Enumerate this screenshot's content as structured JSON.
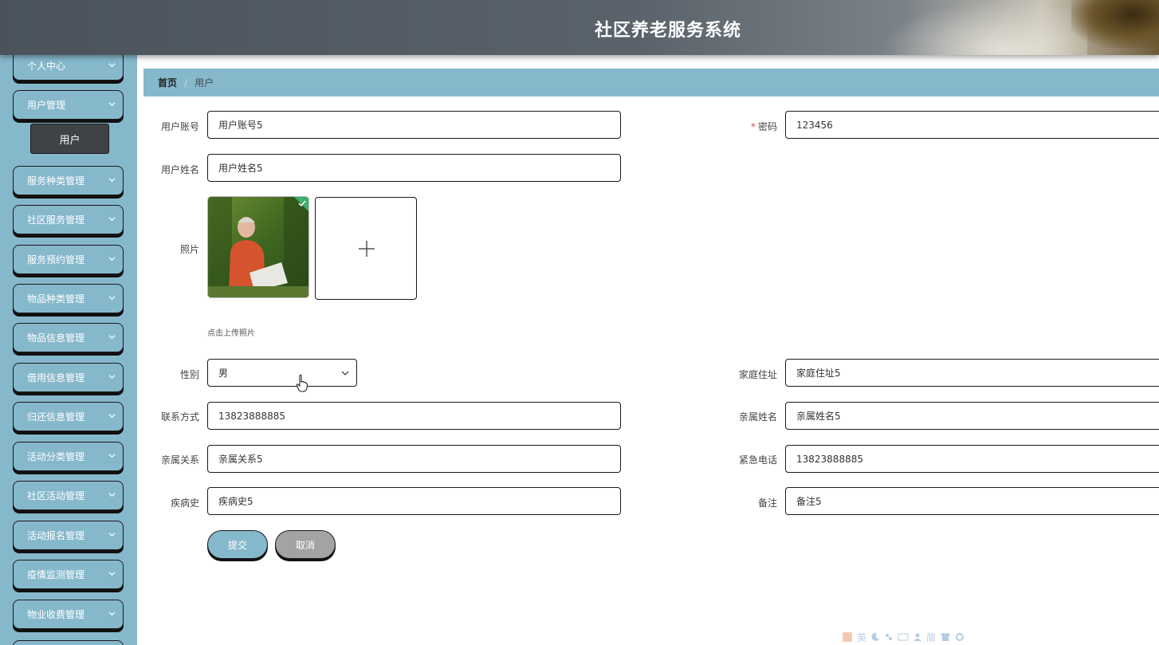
{
  "app": {
    "title": "社区养老服务系统",
    "accent_color": "#86b8cc",
    "header_color": "#5a636b"
  },
  "sidebar": {
    "items": [
      {
        "label": "个人中心",
        "icon": "chevron-down-icon"
      },
      {
        "label": "用户管理",
        "icon": "chevron-down-icon",
        "expanded": true,
        "children": [
          {
            "label": "用户",
            "active": true
          }
        ]
      },
      {
        "label": "服务种类管理",
        "icon": "chevron-down-icon"
      },
      {
        "label": "社区服务管理",
        "icon": "chevron-down-icon"
      },
      {
        "label": "服务预约管理",
        "icon": "chevron-down-icon"
      },
      {
        "label": "物品种类管理",
        "icon": "chevron-down-icon"
      },
      {
        "label": "物品信息管理",
        "icon": "chevron-down-icon"
      },
      {
        "label": "借用信息管理",
        "icon": "chevron-down-icon"
      },
      {
        "label": "归还信息管理",
        "icon": "chevron-down-icon"
      },
      {
        "label": "活动分类管理",
        "icon": "chevron-down-icon"
      },
      {
        "label": "社区活动管理",
        "icon": "chevron-down-icon"
      },
      {
        "label": "活动报名管理",
        "icon": "chevron-down-icon"
      },
      {
        "label": "疫情监测管理",
        "icon": "chevron-down-icon"
      },
      {
        "label": "物业收费管理",
        "icon": "chevron-down-icon"
      }
    ]
  },
  "breadcrumb": {
    "home": "首页",
    "separator": "/",
    "current": "用户"
  },
  "form": {
    "account": {
      "label": "用户账号",
      "value": "用户账号5"
    },
    "password": {
      "label": "密码",
      "required_mark": "*",
      "value": "123456"
    },
    "name": {
      "label": "用户姓名",
      "value": "用户姓名5"
    },
    "photo": {
      "label": "照片",
      "upload_tip": "点击上传照片",
      "upload_icon": "plus-icon",
      "uploaded_badge_icon": "check-icon"
    },
    "gender": {
      "label": "性别",
      "value": "男"
    },
    "address": {
      "label": "家庭住址",
      "value": "家庭住址5"
    },
    "phone": {
      "label": "联系方式",
      "value": "13823888885"
    },
    "relative_name": {
      "label": "亲属姓名",
      "value": "亲属姓名5"
    },
    "relation": {
      "label": "亲属关系",
      "value": "亲属关系5"
    },
    "emergency_phone": {
      "label": "紧急电话",
      "value": "13823888885"
    },
    "medical_history": {
      "label": "疾病史",
      "value": "疾病史5"
    },
    "remark": {
      "label": "备注",
      "value": "备注5"
    }
  },
  "actions": {
    "submit": "提交",
    "cancel": "取消",
    "submit_color": "#86b8cc",
    "cancel_color": "#a3a3a3"
  },
  "ime_toolbar": {
    "lang": "英",
    "mode": "简"
  }
}
